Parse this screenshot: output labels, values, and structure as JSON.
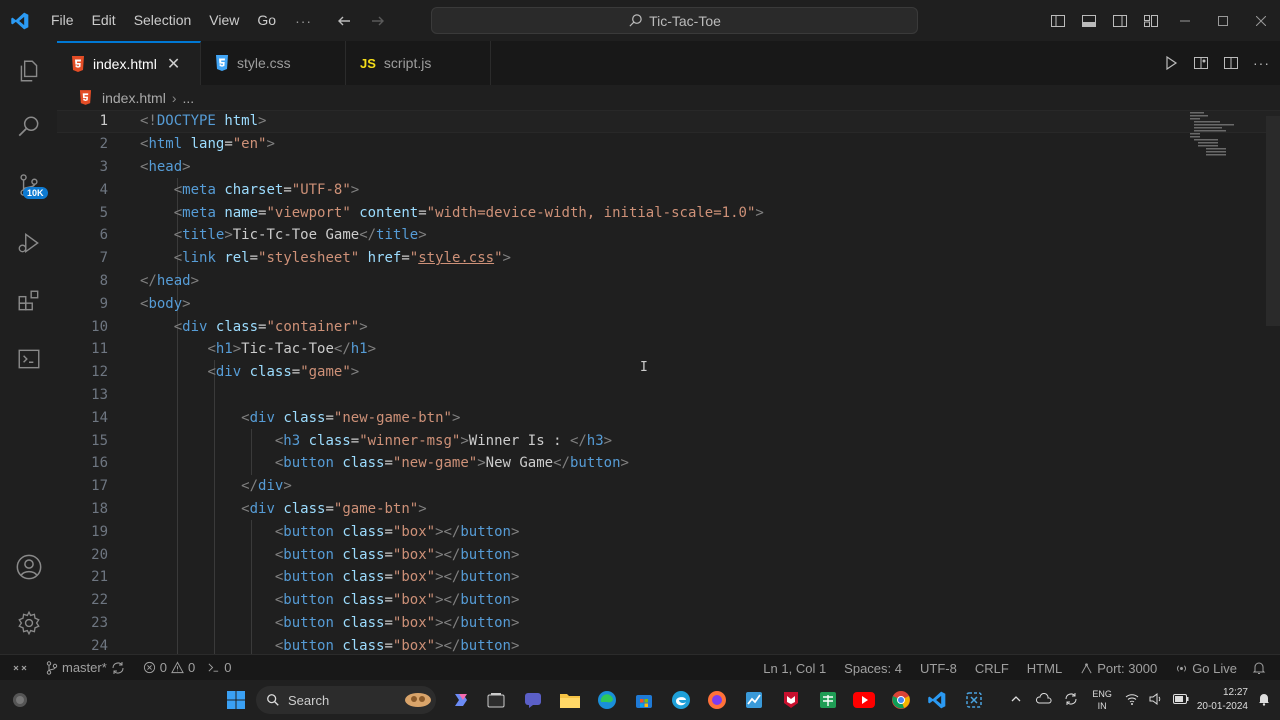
{
  "titlebar": {
    "menu": [
      "File",
      "Edit",
      "Selection",
      "View",
      "Go"
    ],
    "more": "···",
    "search_text": "Tic-Tac-Toe"
  },
  "activity": {
    "badge": "10K"
  },
  "tabs": [
    {
      "label": "index.html",
      "icon": "html5-icon",
      "active": true
    },
    {
      "label": "style.css",
      "icon": "css3-icon",
      "active": false
    },
    {
      "label": "script.js",
      "icon": "js-icon",
      "icon_text": "JS",
      "active": false
    }
  ],
  "breadcrumb": {
    "file": "index.html",
    "more": "..."
  },
  "editor": {
    "lines": [
      {
        "n": "1",
        "html": "<span class=\"t\">&lt;!</span><span class=\"tag\">DOCTYPE</span> <span class=\"attr\">html</span><span class=\"t\">&gt;</span>"
      },
      {
        "n": "2",
        "html": "<span class=\"t\">&lt;</span><span class=\"tag\">html</span> <span class=\"attr\">lang</span>=<span class=\"val\">\"en\"</span><span class=\"t\">&gt;</span>"
      },
      {
        "n": "3",
        "html": "<span class=\"t\">&lt;</span><span class=\"tag\">head</span><span class=\"t\">&gt;</span>"
      },
      {
        "n": "4",
        "html": "    <span class=\"t\">&lt;</span><span class=\"tag\">meta</span> <span class=\"attr\">charset</span>=<span class=\"val\">\"UTF-8\"</span><span class=\"t\">&gt;</span>"
      },
      {
        "n": "5",
        "html": "    <span class=\"t\">&lt;</span><span class=\"tag\">meta</span> <span class=\"attr\">name</span>=<span class=\"val\">\"viewport\"</span> <span class=\"attr\">content</span>=<span class=\"val\">\"width=device-width, initial-scale=1.0\"</span><span class=\"t\">&gt;</span>"
      },
      {
        "n": "6",
        "html": "    <span class=\"t\">&lt;</span><span class=\"tag\">title</span><span class=\"t\">&gt;</span>Tic-Tc-Toe Game<span class=\"t\">&lt;/</span><span class=\"tag\">title</span><span class=\"t\">&gt;</span>"
      },
      {
        "n": "7",
        "html": "    <span class=\"t\">&lt;</span><span class=\"tag\">link</span> <span class=\"attr\">rel</span>=<span class=\"val\">\"stylesheet\"</span> <span class=\"attr\">href</span>=<span class=\"val\">\"<span class=\"u\">style.css</span>\"</span><span class=\"t\">&gt;</span>"
      },
      {
        "n": "8",
        "html": "<span class=\"t\">&lt;/</span><span class=\"tag\">head</span><span class=\"t\">&gt;</span>"
      },
      {
        "n": "9",
        "html": "<span class=\"t\">&lt;</span><span class=\"tag\">body</span><span class=\"t\">&gt;</span>"
      },
      {
        "n": "10",
        "html": "    <span class=\"t\">&lt;</span><span class=\"tag\">div</span> <span class=\"attr\">class</span>=<span class=\"val\">\"container\"</span><span class=\"t\">&gt;</span>"
      },
      {
        "n": "11",
        "html": "        <span class=\"t\">&lt;</span><span class=\"tag\">h1</span><span class=\"t\">&gt;</span>Tic-Tac-Toe<span class=\"t\">&lt;/</span><span class=\"tag\">h1</span><span class=\"t\">&gt;</span>"
      },
      {
        "n": "12",
        "html": "        <span class=\"t\">&lt;</span><span class=\"tag\">div</span> <span class=\"attr\">class</span>=<span class=\"val\">\"game\"</span><span class=\"t\">&gt;</span>"
      },
      {
        "n": "13",
        "html": ""
      },
      {
        "n": "14",
        "html": "            <span class=\"t\">&lt;</span><span class=\"tag\">div</span> <span class=\"attr\">class</span>=<span class=\"val\">\"new-game-btn\"</span><span class=\"t\">&gt;</span>"
      },
      {
        "n": "15",
        "html": "                <span class=\"t\">&lt;</span><span class=\"tag\">h3</span> <span class=\"attr\">class</span>=<span class=\"val\">\"winner-msg\"</span><span class=\"t\">&gt;</span>Winner Is : <span class=\"t\">&lt;/</span><span class=\"tag\">h3</span><span class=\"t\">&gt;</span>"
      },
      {
        "n": "16",
        "html": "                <span class=\"t\">&lt;</span><span class=\"tag\">button</span> <span class=\"attr\">class</span>=<span class=\"val\">\"new-game\"</span><span class=\"t\">&gt;</span>New Game<span class=\"t\">&lt;/</span><span class=\"tag\">button</span><span class=\"t\">&gt;</span>"
      },
      {
        "n": "17",
        "html": "            <span class=\"t\">&lt;/</span><span class=\"tag\">div</span><span class=\"t\">&gt;</span>"
      },
      {
        "n": "18",
        "html": "            <span class=\"t\">&lt;</span><span class=\"tag\">div</span> <span class=\"attr\">class</span>=<span class=\"val\">\"game-btn\"</span><span class=\"t\">&gt;</span>"
      },
      {
        "n": "19",
        "html": "                <span class=\"t\">&lt;</span><span class=\"tag\">button</span> <span class=\"attr\">class</span>=<span class=\"val\">\"box\"</span><span class=\"t\">&gt;&lt;/</span><span class=\"tag\">button</span><span class=\"t\">&gt;</span>"
      },
      {
        "n": "20",
        "html": "                <span class=\"t\">&lt;</span><span class=\"tag\">button</span> <span class=\"attr\">class</span>=<span class=\"val\">\"box\"</span><span class=\"t\">&gt;&lt;/</span><span class=\"tag\">button</span><span class=\"t\">&gt;</span>"
      },
      {
        "n": "21",
        "html": "                <span class=\"t\">&lt;</span><span class=\"tag\">button</span> <span class=\"attr\">class</span>=<span class=\"val\">\"box\"</span><span class=\"t\">&gt;&lt;/</span><span class=\"tag\">button</span><span class=\"t\">&gt;</span>"
      },
      {
        "n": "22",
        "html": "                <span class=\"t\">&lt;</span><span class=\"tag\">button</span> <span class=\"attr\">class</span>=<span class=\"val\">\"box\"</span><span class=\"t\">&gt;&lt;/</span><span class=\"tag\">button</span><span class=\"t\">&gt;</span>"
      },
      {
        "n": "23",
        "html": "                <span class=\"t\">&lt;</span><span class=\"tag\">button</span> <span class=\"attr\">class</span>=<span class=\"val\">\"box\"</span><span class=\"t\">&gt;&lt;/</span><span class=\"tag\">button</span><span class=\"t\">&gt;</span>"
      },
      {
        "n": "24",
        "html": "                <span class=\"t\">&lt;</span><span class=\"tag\">button</span> <span class=\"attr\">class</span>=<span class=\"val\">\"box\"</span><span class=\"t\">&gt;&lt;/</span><span class=\"tag\">button</span><span class=\"t\">&gt;</span>"
      }
    ]
  },
  "statusbar": {
    "branch": "master*",
    "errors": "0",
    "warnings": "0",
    "ports": "0",
    "cursor_pos": "Ln 1, Col 1",
    "spaces": "Spaces: 4",
    "encoding": "UTF-8",
    "eol": "CRLF",
    "language": "HTML",
    "port": "Port: 3000",
    "golive": "Go Live"
  },
  "taskbar": {
    "search_placeholder": "Search",
    "lang_line1": "ENG",
    "lang_line2": "IN",
    "time": "12:27",
    "date": "20-01-2024"
  },
  "colors": {
    "accent": "#0078d4",
    "tag": "#569cd6",
    "attr": "#9cdcfe",
    "string": "#ce9178"
  }
}
